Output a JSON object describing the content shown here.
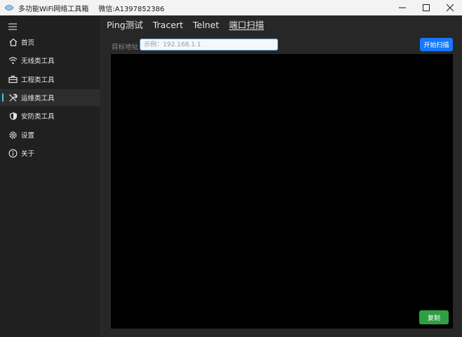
{
  "titlebar": {
    "app_title": "多功能WiFi网络工具箱",
    "contact": "微信:A1397852386"
  },
  "sidebar": {
    "items": [
      {
        "label": "首页",
        "icon": "home-icon"
      },
      {
        "label": "无线类工具",
        "icon": "wifi-icon"
      },
      {
        "label": "工程类工具",
        "icon": "toolbox-icon"
      },
      {
        "label": "运维类工具",
        "icon": "tools-icon",
        "active": true
      },
      {
        "label": "安防类工具",
        "icon": "shield-icon"
      },
      {
        "label": "设置",
        "icon": "gear-icon"
      },
      {
        "label": "关于",
        "icon": "info-icon"
      }
    ]
  },
  "main": {
    "tabs": [
      {
        "label": "Ping测试"
      },
      {
        "label": "Tracert"
      },
      {
        "label": "Telnet"
      },
      {
        "label": "端口扫描",
        "active": true
      }
    ],
    "target_label": "目标地址",
    "target_placeholder": "示例：192.168.1.1",
    "target_value": "",
    "start_button": "开始扫描",
    "output_text": "",
    "copy_button": "复制"
  },
  "colors": {
    "accent": "#4cc2ff",
    "primary_button": "#1677ff",
    "copy_button": "#2ea043",
    "output_background": "#000000"
  }
}
